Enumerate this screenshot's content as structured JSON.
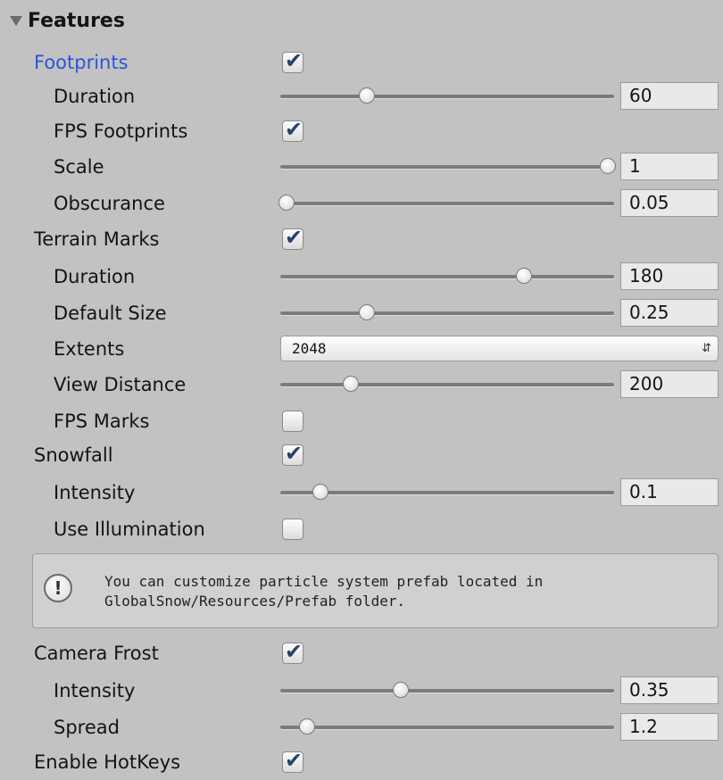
{
  "header": {
    "label": "Features"
  },
  "rows": {
    "footprints": {
      "label": "Footprints",
      "checked": true
    },
    "fp_duration": {
      "label": "Duration",
      "slider_fraction": 0.26,
      "value": "60"
    },
    "fps_footprints": {
      "label": "FPS Footprints",
      "checked": true
    },
    "scale": {
      "label": "Scale",
      "slider_fraction": 0.98,
      "value": "1"
    },
    "obscurance": {
      "label": "Obscurance",
      "slider_fraction": 0.02,
      "value": "0.05"
    },
    "terrain_marks": {
      "label": "Terrain Marks",
      "checked": true
    },
    "tm_duration": {
      "label": "Duration",
      "slider_fraction": 0.73,
      "value": "180"
    },
    "default_size": {
      "label": "Default Size",
      "slider_fraction": 0.26,
      "value": "0.25"
    },
    "extents": {
      "label": "Extents",
      "selected": "2048",
      "arrow_icon": "updown-arrows-icon"
    },
    "view_distance": {
      "label": "View Distance",
      "slider_fraction": 0.21,
      "value": "200"
    },
    "fps_marks": {
      "label": "FPS Marks",
      "checked": false
    },
    "snowfall": {
      "label": "Snowfall",
      "checked": true
    },
    "sf_intensity": {
      "label": "Intensity",
      "slider_fraction": 0.12,
      "value": "0.1"
    },
    "use_illumination": {
      "label": "Use Illumination",
      "checked": false
    },
    "camera_frost": {
      "label": "Camera Frost",
      "checked": true
    },
    "cf_intensity": {
      "label": "Intensity",
      "slider_fraction": 0.36,
      "value": "0.35"
    },
    "spread": {
      "label": "Spread",
      "slider_fraction": 0.08,
      "value": "1.2"
    },
    "enable_hotkeys": {
      "label": "Enable HotKeys",
      "checked": true
    }
  },
  "helpbox": {
    "icon": "info-icon",
    "icon_glyph": "!",
    "line1": "You can customize particle system prefab located in",
    "line2": "GlobalSnow/Resources/Prefab folder."
  },
  "colors": {
    "background": "#c2c2c2",
    "active_label": "#2a55d8",
    "check": "#27426b"
  }
}
